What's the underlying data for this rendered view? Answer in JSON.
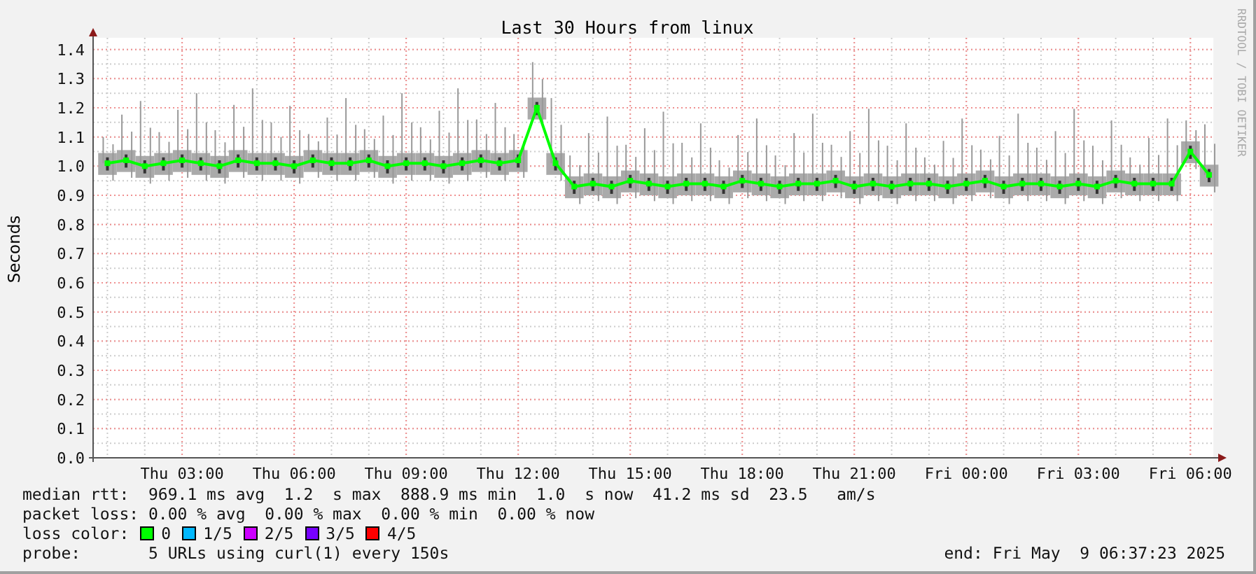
{
  "graph": {
    "title": "Last 30 Hours from linux",
    "watermark": "RRDTOOL / TOBI OETIKER",
    "chart_data": {
      "type": "line",
      "grid": true,
      "ylabel": "Seconds",
      "ylim": [
        0,
        1.44
      ],
      "categories": [
        null,
        null,
        null,
        null,
        "Thu 03:00",
        null,
        null,
        null,
        null,
        null,
        "Thu 06:00",
        null,
        null,
        null,
        null,
        null,
        "Thu 09:00",
        null,
        null,
        null,
        null,
        null,
        "Thu 12:00",
        null,
        null,
        null,
        null,
        null,
        "Thu 15:00",
        null,
        null,
        null,
        null,
        null,
        "Thu 18:00",
        null,
        null,
        null,
        null,
        null,
        "Thu 21:00",
        null,
        null,
        null,
        null,
        null,
        "Fri 00:00",
        null,
        null,
        null,
        null,
        null,
        "Fri 03:00",
        null,
        null,
        null,
        null,
        null,
        "Fri 06:00",
        null
      ],
      "series": [
        {
          "color": "#00ff00",
          "marker": true,
          "values": [
            1.01,
            1.02,
            1.0,
            1.01,
            1.02,
            1.01,
            1.0,
            1.02,
            1.01,
            1.01,
            1.0,
            1.02,
            1.01,
            1.01,
            1.02,
            1.0,
            1.01,
            1.01,
            1.0,
            1.01,
            1.02,
            1.01,
            1.02,
            1.2,
            1.01,
            0.93,
            0.94,
            0.93,
            0.95,
            0.94,
            0.93,
            0.94,
            0.94,
            0.93,
            0.95,
            0.94,
            0.93,
            0.94,
            0.94,
            0.95,
            0.93,
            0.94,
            0.93,
            0.94,
            0.94,
            0.93,
            0.94,
            0.95,
            0.93,
            0.94,
            0.94,
            0.93,
            0.94,
            0.93,
            0.95,
            0.94,
            0.94,
            0.94,
            1.05,
            0.97
          ]
        }
      ],
      "yticks": [
        {
          "value": 0,
          "label": "0.0"
        },
        {
          "value": 0.1,
          "label": "0.1"
        },
        {
          "value": 0.2,
          "label": "0.2"
        },
        {
          "value": 0.3,
          "label": "0.3"
        },
        {
          "value": 0.4,
          "label": "0.4"
        },
        {
          "value": 0.5,
          "label": "0.5"
        },
        {
          "value": 0.6,
          "label": "0.6"
        },
        {
          "value": 0.7,
          "label": "0.7"
        },
        {
          "value": 0.8,
          "label": "0.8"
        },
        {
          "value": 0.9,
          "label": "0.9"
        },
        {
          "value": 1.0,
          "label": "1.0"
        },
        {
          "value": 1.1,
          "label": "1.1"
        },
        {
          "value": 1.2,
          "label": "1.2"
        },
        {
          "value": 1.3,
          "label": "1.3"
        },
        {
          "value": 1.4,
          "label": "1.4"
        }
      ]
    }
  },
  "legend": {
    "median_rtt": "median rtt:  969.1 ms avg  1.2  s max  888.9 ms min  1.0  s now  41.2 ms sd  23.5   am/s",
    "packet_loss": "packet loss: 0.00 % avg  0.00 % max  0.00 % min  0.00 % now",
    "loss_color_label": "loss color:",
    "loss_colors": [
      {
        "label": "0",
        "color": "#00ff00"
      },
      {
        "label": "1/5",
        "color": "#00b8ff"
      },
      {
        "label": "2/5",
        "color": "#cc00ff"
      },
      {
        "label": "3/5",
        "color": "#7700ff"
      },
      {
        "label": "4/5",
        "color": "#ff0000"
      }
    ],
    "probe": "probe:       5 URLs using curl(1) every 150s",
    "end": "end: Fri May  9 06:37:23 2025"
  }
}
